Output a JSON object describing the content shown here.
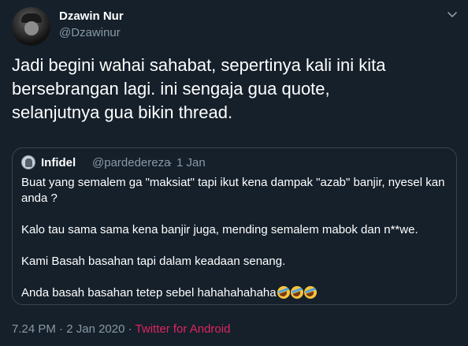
{
  "tweet": {
    "display_name": "Dzawin Nur",
    "handle": "@Dzawinur",
    "text": "Jadi begini wahai sahabat, sepertinya kali ini kita\nbersebrangan lagi. ini sengaja gua quote,\nselanjutnya gua bikin thread.",
    "more_icon": "chevron-down-icon",
    "time": "7.24 PM",
    "separator": "·",
    "date": "2 Jan 2020",
    "source": "Twitter for Android"
  },
  "quote": {
    "display_name": "Infidel",
    "handle": "@pardedereza",
    "separator": "·",
    "date": "1 Jan",
    "paragraphs": [
      "Buat yang semalem ga \"maksiat\" tapi ikut kena dampak \"azab\" banjir, nyesel kan anda ?",
      "Kalo tau sama sama kena banjir juga, mending semalem mabok dan n**we.",
      "Kami Basah basahan tapi dalam keadaan senang.",
      "Anda basah basahan tetep sebel hahahahahaha"
    ],
    "emoji": "rolling-on-floor-laughing-emoji",
    "emoji_count": 3
  },
  "colors": {
    "background": "#15202b",
    "secondary_text": "#8899a6",
    "border": "#38444d",
    "source_link": "#e0245e"
  }
}
